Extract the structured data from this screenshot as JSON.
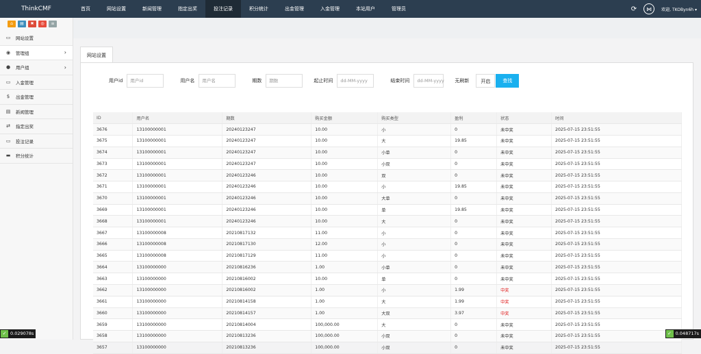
{
  "brand": "ThinkCMF",
  "nav": [
    "首页",
    "网站设置",
    "新闻管理",
    "指定出奖",
    "投注记录",
    "积分统计",
    "出金管理",
    "入金管理",
    "本站用户",
    "管理员"
  ],
  "nav_active_index": 4,
  "topbar": {
    "welcome": "欢迎, TKOByn6h ▾",
    "refresh_icon": "refresh-icon",
    "share_icon": "share-icon"
  },
  "sidebar": {
    "buttons": [
      {
        "icon": "home-icon",
        "color": "#f39c12"
      },
      {
        "icon": "doc-icon",
        "color": "#3c8dbc"
      },
      {
        "icon": "trash-icon",
        "color": "#dd4b39"
      },
      {
        "icon": "lifesaver-icon",
        "color": "#e74c3c"
      },
      {
        "icon": "list-icon",
        "color": "#95a5a6"
      }
    ],
    "items": [
      {
        "label": "网站设置",
        "icon": "monitor-icon",
        "glyph": "▭",
        "arrow": ""
      },
      {
        "label": "管理组",
        "icon": "user-circle-icon",
        "glyph": "◉",
        "arrow": "›"
      },
      {
        "label": "用户组",
        "icon": "user-icon",
        "glyph": "●",
        "arrow": "›"
      },
      {
        "label": "入金管理",
        "icon": "monitor-icon",
        "glyph": "▭",
        "arrow": ""
      },
      {
        "label": "出金管理",
        "icon": "dollar-icon",
        "glyph": "$",
        "arrow": ""
      },
      {
        "label": "新闻管理",
        "icon": "news-icon",
        "glyph": "▤",
        "arrow": ""
      },
      {
        "label": "指定出奖",
        "icon": "exchange-icon",
        "glyph": "⇄",
        "arrow": ""
      },
      {
        "label": "投注记录",
        "icon": "monitor-icon",
        "glyph": "▭",
        "arrow": ""
      },
      {
        "label": "积分统计",
        "icon": "visa-icon",
        "glyph": "▬",
        "arrow": ""
      }
    ]
  },
  "tab_label": "网站设置",
  "filters": {
    "user_id_label": "用户id",
    "user_id_placeholder": "用户id",
    "username_label": "用户名",
    "username_placeholder": "用户名",
    "issue_label": "期数",
    "issue_placeholder": "期数",
    "start_label": "起止时间",
    "start_placeholder": "dd-MM-yyyy",
    "end_label": "结束时间",
    "end_placeholder": "dd-MM-yyyy",
    "refresh_label": "无刷新",
    "refresh_value": "开启",
    "search_button": "查找"
  },
  "table": {
    "columns": [
      "ID",
      "用户名",
      "期数",
      "购买金额",
      "购买类型",
      "盈利",
      "状态",
      "时间"
    ],
    "rows": [
      [
        "3676",
        "13100000001",
        "20240123247",
        "10.00",
        "小",
        "0",
        "未中奖",
        "2025-07-15 23:51:55"
      ],
      [
        "3675",
        "13100000001",
        "20240123247",
        "10.00",
        "大",
        "19.85",
        "未中奖",
        "2025-07-15 23:51:55"
      ],
      [
        "3674",
        "13100000001",
        "20240123247",
        "10.00",
        "小单",
        "0",
        "未中奖",
        "2025-07-15 23:51:55"
      ],
      [
        "3673",
        "13100000001",
        "20240123247",
        "10.00",
        "小双",
        "0",
        "未中奖",
        "2025-07-15 23:51:55"
      ],
      [
        "3672",
        "13100000001",
        "20240123246",
        "10.00",
        "双",
        "0",
        "未中奖",
        "2025-07-15 23:51:55"
      ],
      [
        "3671",
        "13100000001",
        "20240123246",
        "10.00",
        "小",
        "19.85",
        "未中奖",
        "2025-07-15 23:51:55"
      ],
      [
        "3670",
        "13100000001",
        "20240123246",
        "10.00",
        "大单",
        "0",
        "未中奖",
        "2025-07-15 23:51:55"
      ],
      [
        "3669",
        "13100000001",
        "20240123246",
        "10.00",
        "单",
        "19.85",
        "未中奖",
        "2025-07-15 23:51:55"
      ],
      [
        "3668",
        "13100000001",
        "20240123246",
        "10.00",
        "大",
        "0",
        "未中奖",
        "2025-07-15 23:51:55"
      ],
      [
        "3667",
        "13100000008",
        "20210817132",
        "11.00",
        "小",
        "0",
        "未中奖",
        "2025-07-15 23:51:55"
      ],
      [
        "3666",
        "13100000008",
        "20210817130",
        "12.00",
        "小",
        "0",
        "未中奖",
        "2025-07-15 23:51:55"
      ],
      [
        "3665",
        "13100000008",
        "20210817129",
        "11.00",
        "小",
        "0",
        "未中奖",
        "2025-07-15 23:51:55"
      ],
      [
        "3664",
        "13100000000",
        "20210816236",
        "1.00",
        "小单",
        "0",
        "未中奖",
        "2025-07-15 23:51:55"
      ],
      [
        "3663",
        "13100000000",
        "20210816002",
        "10.00",
        "单",
        "0",
        "未中奖",
        "2025-07-15 23:51:55"
      ],
      [
        "3662",
        "13100000000",
        "20210816002",
        "1.00",
        "小",
        "1.99",
        "中奖",
        "2025-07-15 23:51:55"
      ],
      [
        "3661",
        "13100000000",
        "20210814158",
        "1.00",
        "大",
        "1.99",
        "中奖",
        "2025-07-15 23:51:55"
      ],
      [
        "3660",
        "13100000000",
        "20210814157",
        "1.00",
        "大双",
        "3.97",
        "中奖",
        "2025-07-15 23:51:55"
      ],
      [
        "3659",
        "13100000000",
        "20210814004",
        "100,000.00",
        "大",
        "0",
        "未中奖",
        "2025-07-15 23:51:55"
      ],
      [
        "3658",
        "13100000000",
        "20210813236",
        "100,000.00",
        "小双",
        "0",
        "未中奖",
        "2025-07-15 23:51:55"
      ],
      [
        "3657",
        "13100000000",
        "20210813236",
        "100,000.00",
        "小双",
        "0",
        "未中奖",
        "2025-07-15 23:51:55"
      ]
    ],
    "win_status": "中奖",
    "win_color": "#e02020"
  },
  "perf": {
    "left": "0.029078s",
    "right": "0.048717s",
    "icon": "leaf-icon"
  }
}
